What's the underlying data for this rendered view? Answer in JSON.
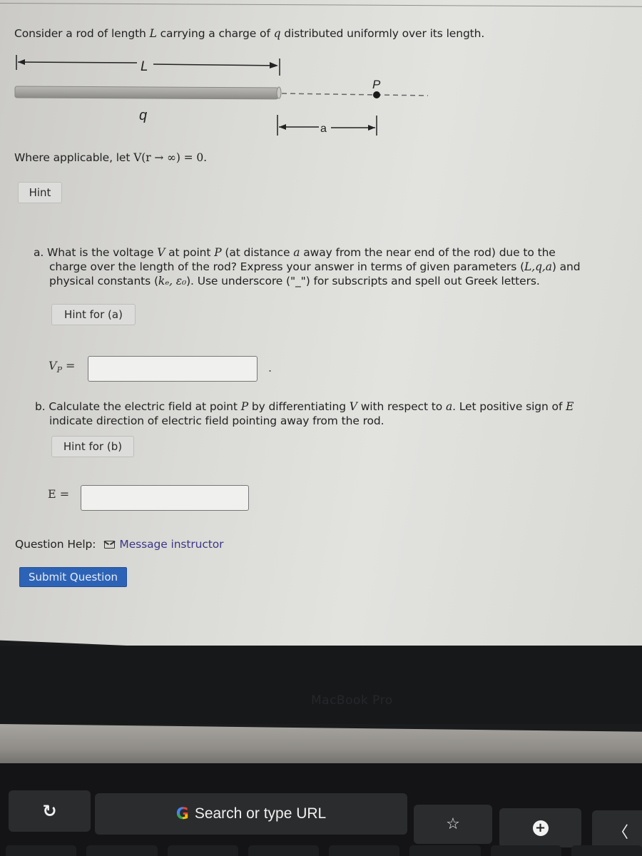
{
  "problem": {
    "intro_pre": "Consider a rod of length ",
    "intro_L": "L",
    "intro_mid": " carrying a charge of ",
    "intro_q": "q",
    "intro_post": " distributed uniformly over its length.",
    "diagram": {
      "length_label": "L",
      "charge_label": "q",
      "point_label": "P",
      "distance_label": "a"
    },
    "where_pre": "Where applicable, let ",
    "where_math": "V(r → ∞) = 0.",
    "hint_button": "Hint"
  },
  "part_a": {
    "line1_pre": "a. What is the voltage ",
    "line1_V": "V",
    "line1_mid": " at point ",
    "line1_P": "P",
    "line1_mid2": " (at distance ",
    "line1_a": "a",
    "line1_post": " away from the near end of the rod) due to the",
    "line2_pre": "charge over the length of the rod? Express your answer in terms of given parameters (",
    "line2_params": "L,q,a",
    "line2_post": ") and",
    "line3_pre": "physical constants (",
    "line3_consts": "kₑ, ε₀",
    "line3_post": "). Use underscore (\"_\") for subscripts and spell out Greek letters.",
    "hint_button": "Hint for (a)",
    "answer_label": "V_P =",
    "answer_value": "",
    "answer_suffix": "."
  },
  "part_b": {
    "line1_pre": "b. Calculate the electric field at point ",
    "line1_P": "P",
    "line1_mid": " by differentiating ",
    "line1_V": "V",
    "line1_mid2": " with respect to ",
    "line1_a": "a",
    "line1_post": ". Let positive sign of ",
    "line1_E": "E",
    "line2": "indicate direction of electric field pointing away from the rod.",
    "hint_button": "Hint for (b)",
    "answer_label": "E =",
    "answer_value": ""
  },
  "footer": {
    "help_label": "Question Help:",
    "help_icon": "mail-icon",
    "message_link": "Message instructor",
    "submit_button": "Submit Question"
  },
  "device": {
    "brand": "MacBook Pro",
    "touchbar": {
      "reload_icon": "↻",
      "search_placeholder": "Search or type URL",
      "google_glyph": "G",
      "star_icon": "☆",
      "new_tab_icon": "+",
      "back_icon": "〈"
    }
  },
  "colors": {
    "submit_bg": "#2d63b6",
    "link": "#3b3786",
    "page_bg": "#dadad6"
  }
}
